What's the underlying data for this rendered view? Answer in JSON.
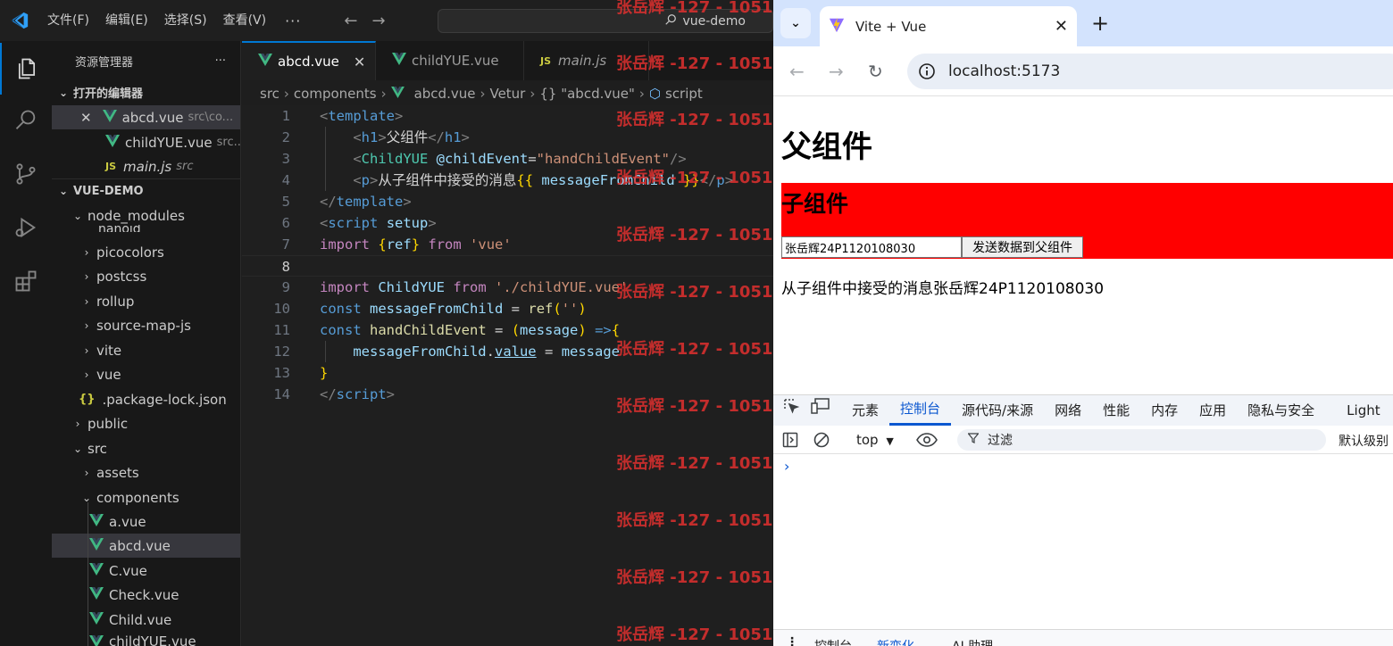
{
  "vscode": {
    "menu": [
      "文件(F)",
      "编辑(E)",
      "选择(S)",
      "查看(V)"
    ],
    "menu_more": "···",
    "command_center": "vue-demo",
    "explorer_title": "资源管理器",
    "explorer_more": "···",
    "open_editors_label": "打开的编辑器",
    "open_editors": [
      {
        "name": "abcd.vue",
        "path": "src\\co...",
        "type": "vue"
      },
      {
        "name": "childYUE.vue",
        "path": "src...",
        "type": "vue"
      },
      {
        "name": "main.js",
        "path": "src",
        "type": "js"
      }
    ],
    "project_label": "VUE-DEMO",
    "tree": {
      "node_modules": "node_modules",
      "nanoid": "nanoid",
      "picocolors": "picocolors",
      "postcss": "postcss",
      "rollup": "rollup",
      "source_map_js": "source-map-js",
      "vite": "vite",
      "vue": "vue",
      "package_lock": ".package-lock.json",
      "public": "public",
      "src": "src",
      "assets": "assets",
      "components": "components",
      "a_vue": "a.vue",
      "abcd_vue": "abcd.vue",
      "c_vue": "C.vue",
      "check_vue": "Check.vue",
      "child_vue": "Child.vue",
      "childyue_vue": "childYUE.vue"
    },
    "tabs": [
      {
        "label": "abcd.vue",
        "type": "vue",
        "active": true
      },
      {
        "label": "childYUE.vue",
        "type": "vue",
        "active": false
      },
      {
        "label": "main.js",
        "type": "js",
        "active": false
      }
    ],
    "breadcrumb": [
      "src",
      "components",
      "abcd.vue",
      "Vetur",
      "{} \"abcd.vue\"",
      "script"
    ],
    "code_line_numbers": [
      "1",
      "2",
      "3",
      "4",
      "5",
      "6",
      "7",
      "8",
      "9",
      "10",
      "11",
      "12",
      "13",
      "14"
    ],
    "current_line": 8
  },
  "watermark_text": "张岳辉 -127 - 1051",
  "browser": {
    "tab_title": "Vite + Vue",
    "url": "localhost:5173",
    "page": {
      "h1": "父组件",
      "h2": "子组件",
      "input_value": "张岳辉24P1120108030",
      "button_label": "发送数据到父组件",
      "message": "从子组件中接受的消息张岳辉24P1120108030"
    },
    "devtools": {
      "tabs": [
        "元素",
        "控制台",
        "源代码/来源",
        "网络",
        "性能",
        "内存",
        "应用",
        "隐私与安全",
        "Light"
      ],
      "active_tab": "控制台",
      "context": "top",
      "filter_placeholder": "过滤",
      "level": "默认级别",
      "prompt": "›",
      "drawer_tabs": [
        "控制台",
        "新变化",
        "AI 助理"
      ]
    }
  },
  "colors": {
    "accent_blue": "#0078d4",
    "vue_green": "#41b883",
    "child_bg": "#ff0000",
    "watermark": "#e0302f"
  }
}
